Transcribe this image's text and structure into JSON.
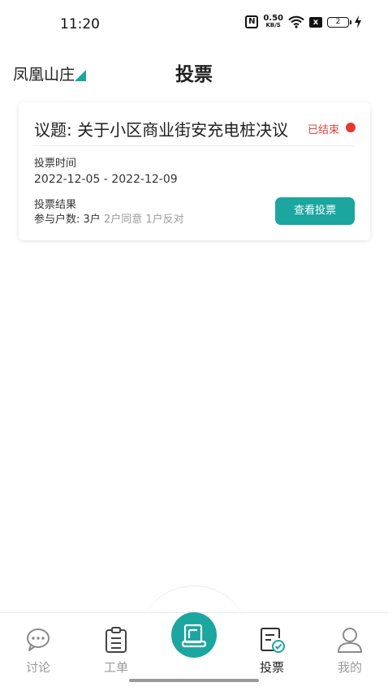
{
  "status_bar": {
    "time": "11:20",
    "nfc": "N",
    "net_speed_value": "0.50",
    "net_speed_unit": "KB/S",
    "sim": "x",
    "battery": "2",
    "icons": [
      "nfc-icon",
      "wifi-icon",
      "sim-icon",
      "battery-icon",
      "charging-icon"
    ]
  },
  "header": {
    "community": "凤凰山庄",
    "title": "投票"
  },
  "vote": {
    "topic": "议题: 关于小区商业街安充电桩决议",
    "status": "已结束",
    "status_color": "#e53935",
    "time_label": "投票时间",
    "time_value": "2022-12-05 - 2022-12-09",
    "result_label": "投票结果",
    "participants": "参与户数: 3户",
    "agree": "2户同意",
    "oppose": "1户反对",
    "view_button": "查看投票"
  },
  "bottom_nav": {
    "items": [
      {
        "label": "讨论",
        "icon": "chat-icon",
        "active": false
      },
      {
        "label": "工单",
        "icon": "clipboard-icon",
        "active": false
      },
      {
        "label": "投票",
        "icon": "vote-icon",
        "active": true
      },
      {
        "label": "我的",
        "icon": "user-icon",
        "active": false
      }
    ],
    "center_icon": "scroll-icon"
  },
  "colors": {
    "accent": "#1ba6a0",
    "status_red": "#e53935",
    "muted_text": "#9a9a9a"
  }
}
